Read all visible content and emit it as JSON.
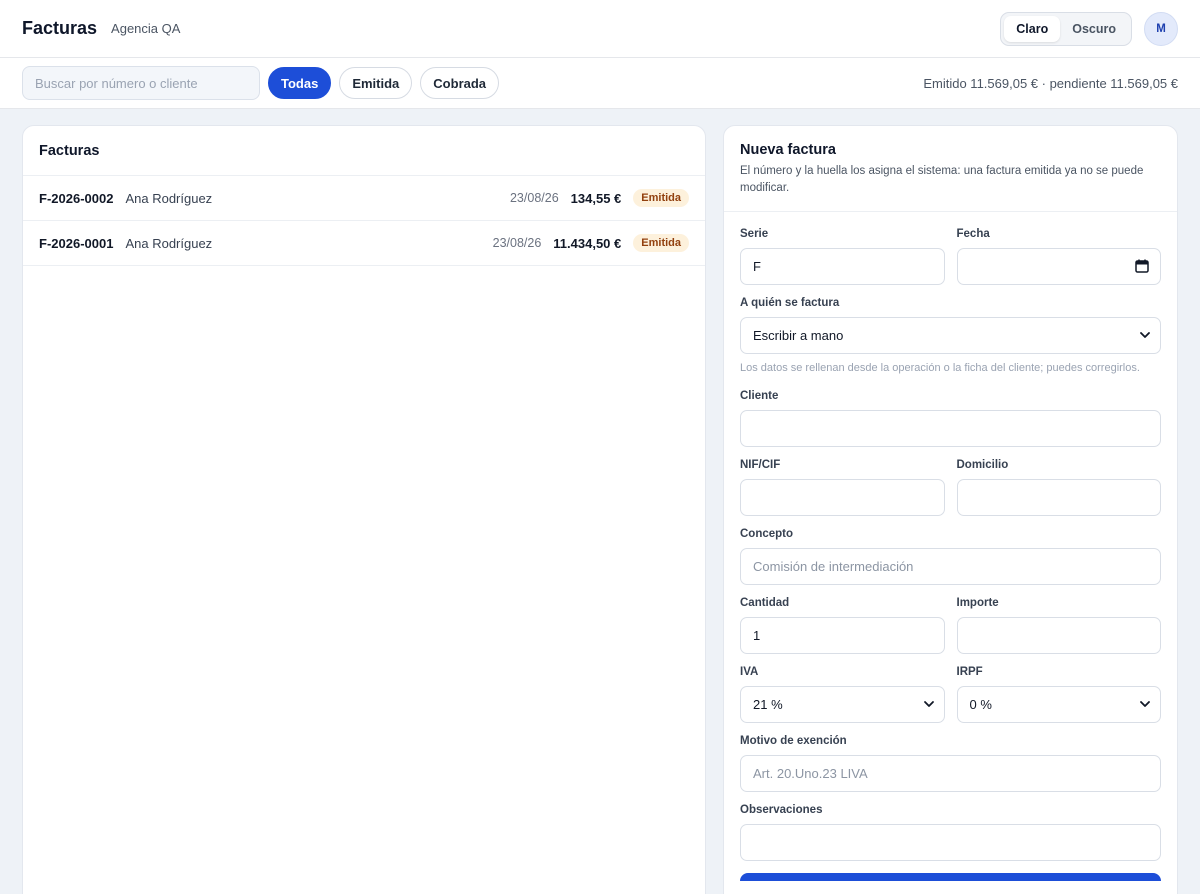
{
  "header": {
    "title": "Facturas",
    "subtitle": "Agencia QA",
    "theme_light": "Claro",
    "theme_dark": "Oscuro",
    "avatar_initial": "M"
  },
  "filters": {
    "search_placeholder": "Buscar por número o cliente",
    "all": "Todas",
    "issued": "Emitida",
    "paid": "Cobrada",
    "summary": "Emitido 11.569,05 € · pendiente 11.569,05 €"
  },
  "list": {
    "title": "Facturas",
    "rows": [
      {
        "number": "F-2026-0002",
        "client": "Ana Rodríguez",
        "date": "23/08/26",
        "amount": "134,55 €",
        "status": "Emitida"
      },
      {
        "number": "F-2026-0001",
        "client": "Ana Rodríguez",
        "date": "23/08/26",
        "amount": "11.434,50 €",
        "status": "Emitida"
      }
    ]
  },
  "form": {
    "title": "Nueva factura",
    "description": "El número y la huella los asigna el sistema: una factura emitida ya no se puede modificar.",
    "serie_label": "Serie",
    "serie_value": "F",
    "fecha_label": "Fecha",
    "recipient_label": "A quién se factura",
    "recipient_value": "Escribir a mano",
    "recipient_help": "Los datos se rellenan desde la operación o la ficha del cliente; puedes corregirlos.",
    "client_label": "Cliente",
    "nif_label": "NIF/CIF",
    "address_label": "Domicilio",
    "concept_label": "Concepto",
    "concept_placeholder": "Comisión de intermediación",
    "qty_label": "Cantidad",
    "qty_value": "1",
    "amount_label": "Importe",
    "iva_label": "IVA",
    "iva_value": "21 %",
    "irpf_label": "IRPF",
    "irpf_value": "0 %",
    "exemption_label": "Motivo de exención",
    "exemption_placeholder": "Art. 20.Uno.23 LIVA",
    "notes_label": "Observaciones"
  }
}
